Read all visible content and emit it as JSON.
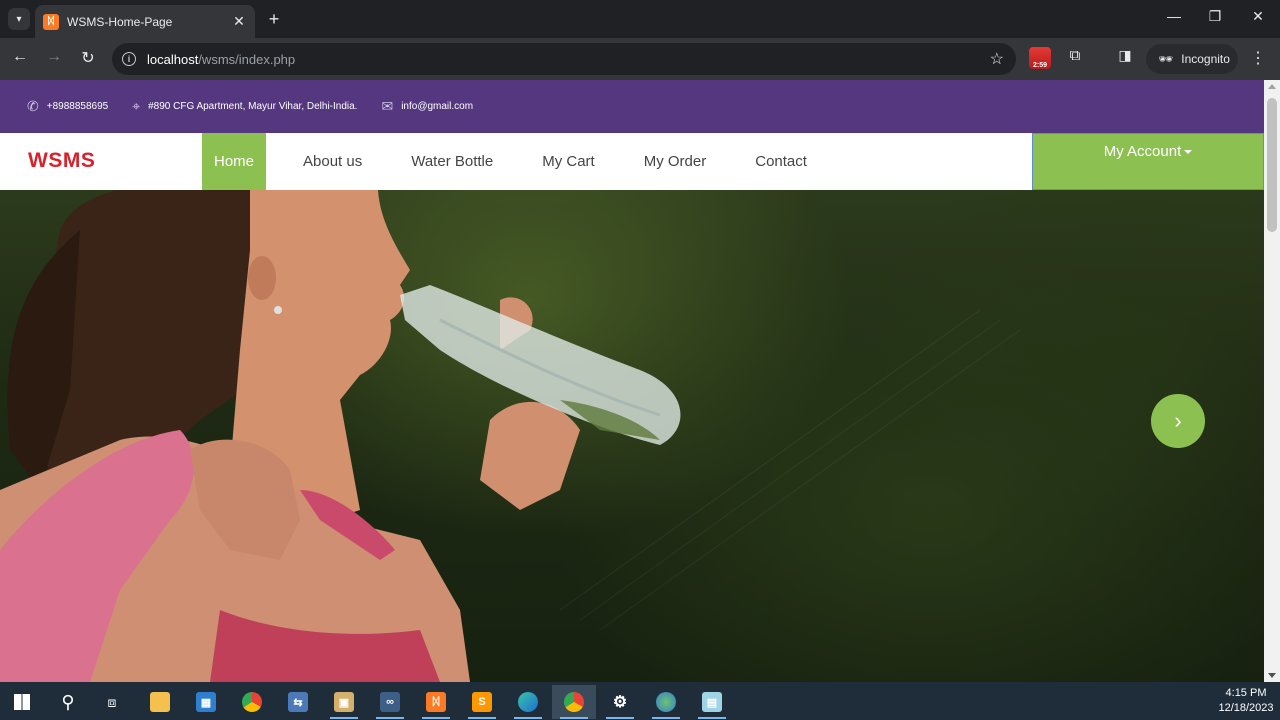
{
  "browser": {
    "tab_title": "WSMS-Home-Page",
    "url_host": "localhost",
    "url_path": "/wsms/index.php",
    "incognito_label": "Incognito",
    "extension_badge": "2:59"
  },
  "topbar": {
    "phone": "+8988858695",
    "address": "#890 CFG Apartment, Mayur Vihar, Delhi-India.",
    "email": "info@gmail.com"
  },
  "navbar": {
    "brand": "WSMS",
    "links": [
      "Home",
      "About us",
      "Water Bottle",
      "My Cart",
      "My Order",
      "Contact"
    ],
    "account_label": "My Account"
  },
  "hero": {
    "next_label": "›"
  },
  "taskbar": {
    "time": "4:15 PM",
    "date": "12/18/2023"
  },
  "colors": {
    "topbar_bg": "#55377f",
    "accent_green": "#8cc152",
    "brand_red": "#d7222b"
  }
}
